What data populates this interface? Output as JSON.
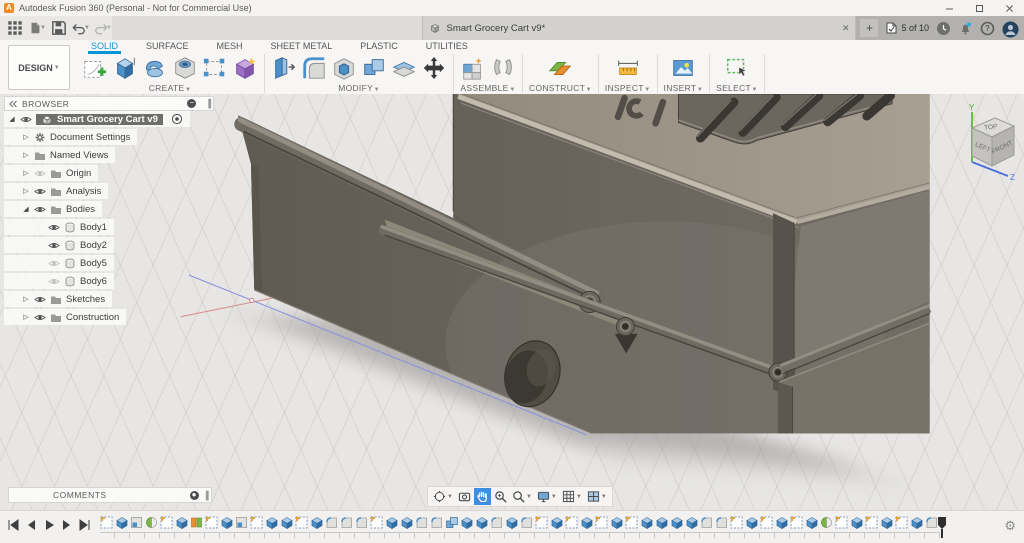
{
  "window": {
    "title": "Autodesk Fusion 360 (Personal - Not for Commercial Use)",
    "logo_letter": "A",
    "controls": [
      "minimize-icon",
      "maximize-icon",
      "close-icon"
    ]
  },
  "appbar": {
    "left_icons": [
      "apps-grid-icon",
      "file-icon",
      "save-icon",
      "undo-icon",
      "redo-icon"
    ],
    "tab": {
      "label": "Smart Grocery Cart v9*",
      "close": "x"
    },
    "new_tab": "+",
    "session": {
      "label": "5 of 10"
    },
    "right_icons": [
      "clock-icon",
      "bell-icon",
      "help-icon",
      "avatar"
    ]
  },
  "ribbon": {
    "design_label": "DESIGN",
    "tabs": [
      {
        "label": "SOLID",
        "active": true
      },
      {
        "label": "SURFACE",
        "active": false
      },
      {
        "label": "MESH",
        "active": false
      },
      {
        "label": "SHEET METAL",
        "active": false
      },
      {
        "label": "PLASTIC",
        "active": false
      },
      {
        "label": "UTILITIES",
        "active": false
      }
    ],
    "groups": [
      {
        "label": "CREATE",
        "icons": [
          "create-sketch",
          "extrude",
          "revolve",
          "hole",
          "form-box",
          "create-form"
        ]
      },
      {
        "label": "MODIFY",
        "icons": [
          "press-pull",
          "fillet",
          "shell",
          "combine",
          "split",
          "move"
        ]
      },
      {
        "label": "ASSEMBLE",
        "icons": [
          "new-component",
          "joint"
        ]
      },
      {
        "label": "CONSTRUCT",
        "icons": [
          "construct-plane"
        ]
      },
      {
        "label": "INSPECT",
        "icons": [
          "measure"
        ]
      },
      {
        "label": "INSERT",
        "icons": [
          "insert-image"
        ]
      },
      {
        "label": "SELECT",
        "icons": [
          "select"
        ]
      }
    ]
  },
  "browser": {
    "header": "BROWSER",
    "rows": [
      {
        "label": "Smart Grocery Cart v9",
        "indent": 0,
        "expander": "open",
        "eye": "on",
        "icon": "cube",
        "selected": true,
        "radio": true
      },
      {
        "label": "Document Settings",
        "indent": 1,
        "expander": "closed",
        "eye": null,
        "icon": "gear",
        "selected": false,
        "radio": false
      },
      {
        "label": "Named Views",
        "indent": 1,
        "expander": "closed",
        "eye": null,
        "icon": "folder",
        "selected": false,
        "radio": false
      },
      {
        "label": "Origin",
        "indent": 1,
        "expander": "closed",
        "eye": "off",
        "icon": "folder",
        "selected": false,
        "radio": false
      },
      {
        "label": "Analysis",
        "indent": 1,
        "expander": "closed",
        "eye": "on",
        "icon": "folder",
        "selected": false,
        "radio": false
      },
      {
        "label": "Bodies",
        "indent": 1,
        "expander": "open",
        "eye": "on",
        "icon": "folder",
        "selected": false,
        "radio": false
      },
      {
        "label": "Body1",
        "indent": 2,
        "expander": null,
        "eye": "on",
        "icon": "body",
        "selected": false,
        "radio": false
      },
      {
        "label": "Body2",
        "indent": 2,
        "expander": null,
        "eye": "on",
        "icon": "body",
        "selected": false,
        "radio": false
      },
      {
        "label": "Body5",
        "indent": 2,
        "expander": null,
        "eye": "off",
        "icon": "body",
        "selected": false,
        "radio": false
      },
      {
        "label": "Body6",
        "indent": 2,
        "expander": null,
        "eye": "off",
        "icon": "body",
        "selected": false,
        "radio": false
      },
      {
        "label": "Sketches",
        "indent": 1,
        "expander": "closed",
        "eye": "on",
        "icon": "folder",
        "selected": false,
        "radio": false
      },
      {
        "label": "Construction",
        "indent": 1,
        "expander": "closed",
        "eye": "on",
        "icon": "folder",
        "selected": false,
        "radio": false
      }
    ]
  },
  "viewport": {
    "viewcube": {
      "top": "TOP",
      "left": "LEFT",
      "front": "FRONT",
      "axis_y": "Y",
      "axis_z": "Z"
    },
    "comments_label": "COMMENTS",
    "navbar": [
      {
        "name": "orbit",
        "caret": true,
        "active": false
      },
      {
        "name": "look-at",
        "caret": false,
        "active": false
      },
      {
        "name": "pan",
        "caret": false,
        "active": true
      },
      {
        "name": "zoom",
        "caret": false,
        "active": false
      },
      {
        "name": "fit",
        "caret": true,
        "active": false
      },
      {
        "name": "display",
        "caret": true,
        "active": false
      },
      {
        "name": "grid",
        "caret": true,
        "active": false
      },
      {
        "name": "viewports",
        "caret": true,
        "active": false
      }
    ]
  },
  "timeline": {
    "playback": [
      "skip-start",
      "step-back",
      "play",
      "step-forward",
      "skip-end"
    ],
    "sequence": [
      "sk",
      "ex",
      "sh",
      "mg",
      "sk",
      "ex",
      "mo",
      "sk",
      "ex",
      "sh",
      "sk",
      "ex",
      "ex",
      "sk",
      "ex",
      "fi",
      "fi",
      "fi",
      "sk",
      "ex",
      "ex",
      "fi",
      "fi",
      "cb",
      "ex",
      "ex",
      "fi",
      "ex",
      "fi",
      "sk",
      "ex",
      "sk",
      "ex",
      "sk",
      "ex",
      "sk",
      "ex",
      "ex",
      "ex",
      "ex",
      "fi",
      "fi",
      "sk",
      "ex",
      "sk",
      "ex",
      "sk",
      "ex",
      "mg",
      "sk",
      "ex",
      "sk",
      "ex",
      "sk",
      "ex",
      "fi"
    ],
    "feature_names": {
      "sk": "sketch",
      "ex": "extrude",
      "sh": "shell",
      "mg": "mirror",
      "mo": "mirror",
      "fi": "fillet",
      "cb": "combine"
    }
  },
  "colors": {
    "accent": "#0696d7",
    "selection_blue": "#3b8ee0",
    "logo_orange": "#f6891f",
    "model_top": "#a39b8e",
    "model_front": "#6b665e"
  }
}
